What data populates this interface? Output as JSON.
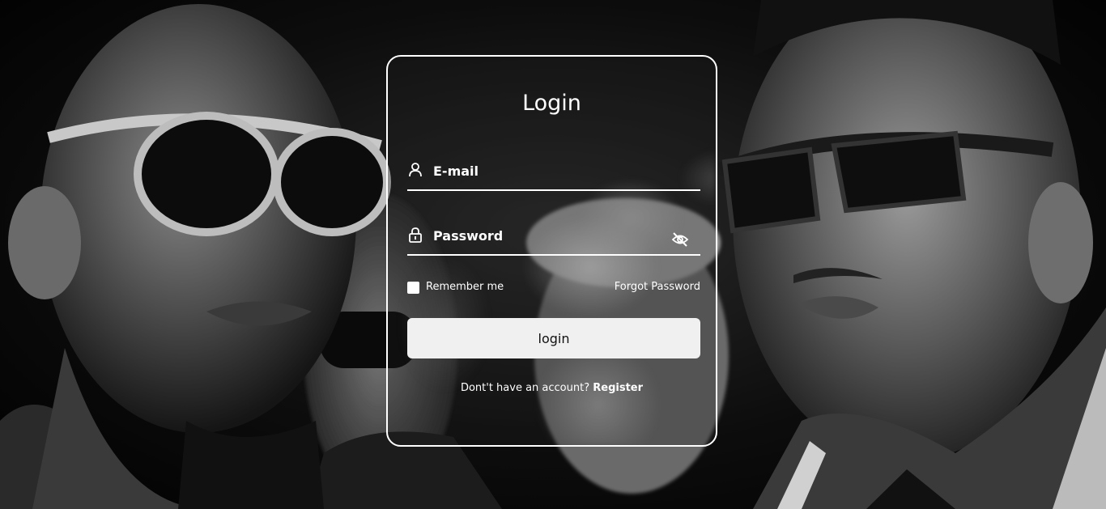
{
  "form": {
    "title": "Login",
    "email_label": "E-mail",
    "password_label": "Password",
    "remember_label": "Remember me",
    "forgot_label": "Forgot Password",
    "login_button": "login",
    "no_account_text": "Dont't have an account?",
    "register_link": "Register"
  },
  "icons": {
    "email": "user-icon",
    "password": "lock-icon",
    "toggle_visibility": "eye-off-icon"
  },
  "colors": {
    "background": "#000000",
    "text": "#ffffff",
    "button_bg": "#f0f0f0",
    "button_text": "#111111"
  }
}
